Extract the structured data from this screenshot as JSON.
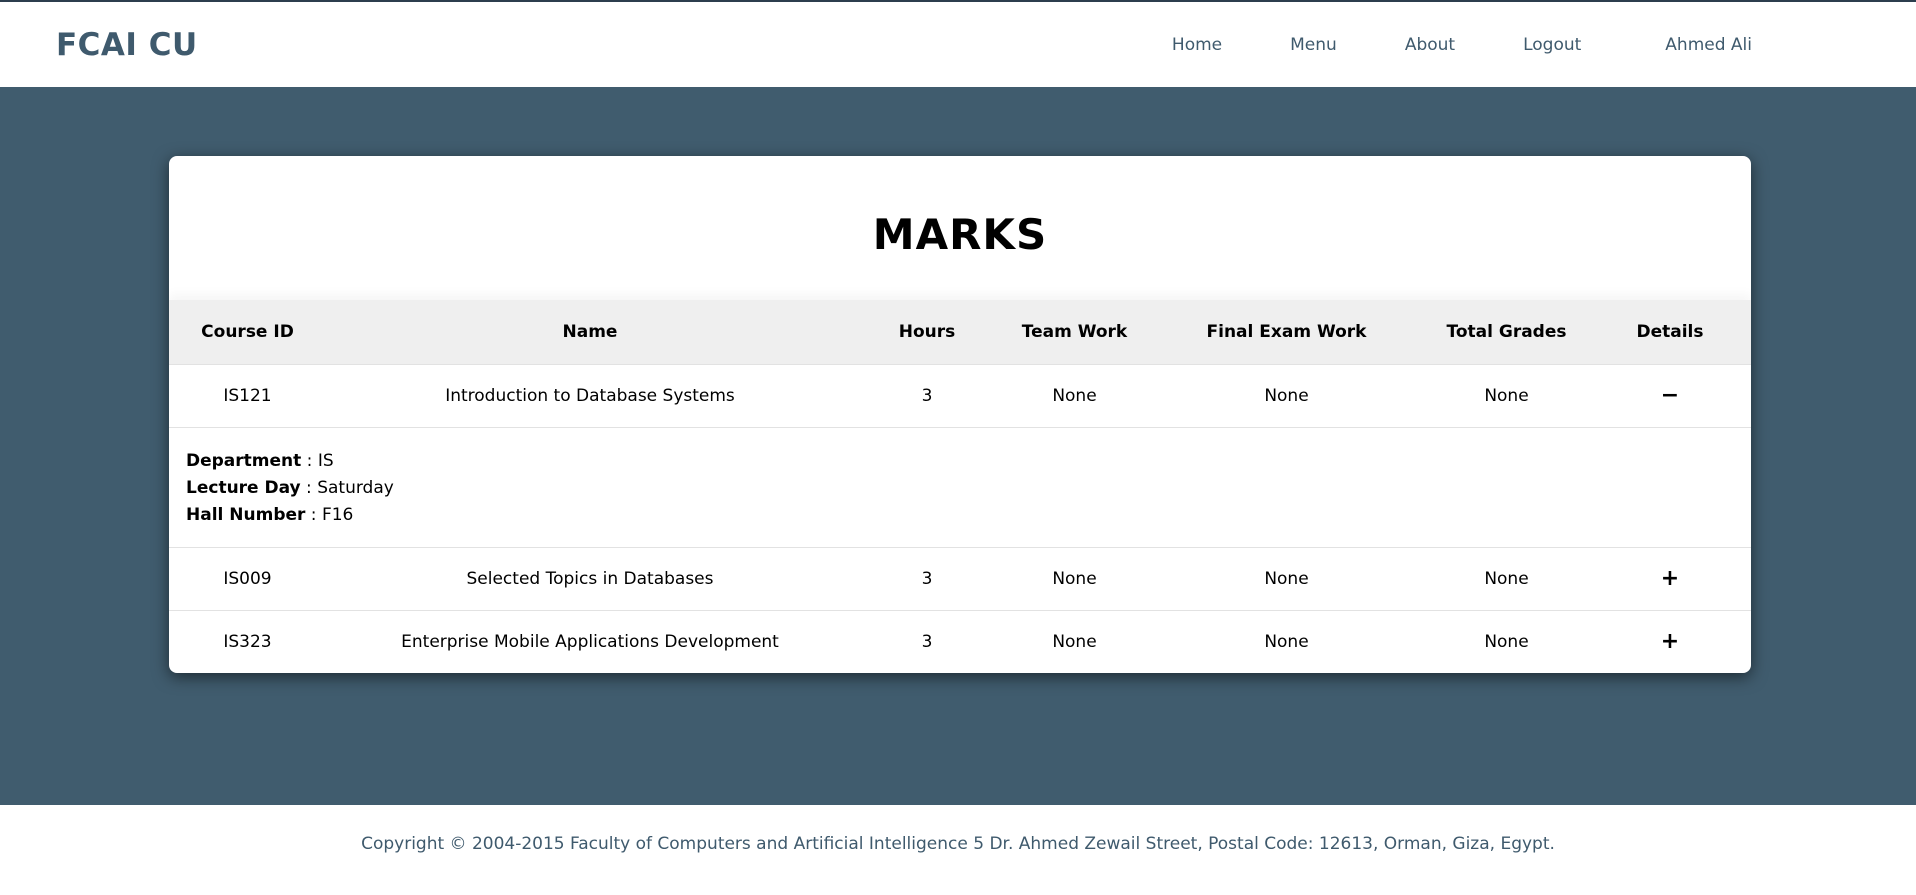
{
  "header": {
    "brand": "FCAI CU",
    "nav": {
      "home": "Home",
      "menu": "Menu",
      "about": "About",
      "logout": "Logout",
      "user": "Ahmed Ali"
    }
  },
  "marks": {
    "title": "MARKS",
    "columns": {
      "course_id": "Course ID",
      "name": "Name",
      "hours": "Hours",
      "team_work": "Team Work",
      "final_exam": "Final Exam Work",
      "total": "Total Grades",
      "details": "Details"
    },
    "rows": [
      {
        "course_id": "IS121",
        "name": "Introduction to Database Systems",
        "hours": "3",
        "team_work": "None",
        "final_exam": "None",
        "total": "None",
        "toggle": "−",
        "details": {
          "department_label": "Department",
          "department": "IS",
          "lecture_day_label": "Lecture Day",
          "lecture_day": "Saturday",
          "hall_label": "Hall Number",
          "hall": "F16"
        }
      },
      {
        "course_id": "IS009",
        "name": "Selected Topics in Databases",
        "hours": "3",
        "team_work": "None",
        "final_exam": "None",
        "total": "None",
        "toggle": "+"
      },
      {
        "course_id": "IS323",
        "name": "Enterprise Mobile Applications Development",
        "hours": "3",
        "team_work": "None",
        "final_exam": "None",
        "total": "None",
        "toggle": "+"
      }
    ]
  },
  "footer": {
    "copyright": "Copyright © 2004-2015 Faculty of Computers and Artificial Intelligence 5 Dr. Ahmed Zewail Street, Postal Code: 12613, Orman, Giza, Egypt."
  },
  "colors": {
    "brand": "#3f5a6d",
    "background": "#405c6e",
    "table_header": "#efefef"
  }
}
